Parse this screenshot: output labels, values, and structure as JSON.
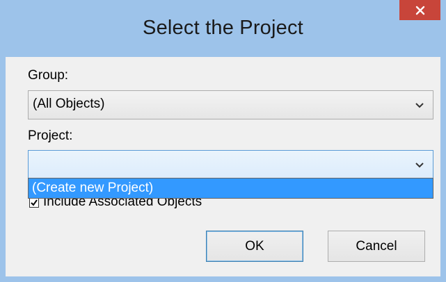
{
  "dialog": {
    "title": "Select the Project",
    "close_icon": "close-icon"
  },
  "group": {
    "label": "Group:",
    "value": "(All Objects)"
  },
  "project": {
    "label": "Project:",
    "value": "",
    "options": [
      "(Create new Project)"
    ],
    "highlighted_option": "(Create new Project)"
  },
  "include_associated": {
    "label": "Include Associated Objects",
    "checked": true
  },
  "buttons": {
    "ok": "OK",
    "cancel": "Cancel"
  },
  "colors": {
    "titlebar": "#9dc3ea",
    "close": "#c8453a",
    "selection": "#3399ff"
  }
}
